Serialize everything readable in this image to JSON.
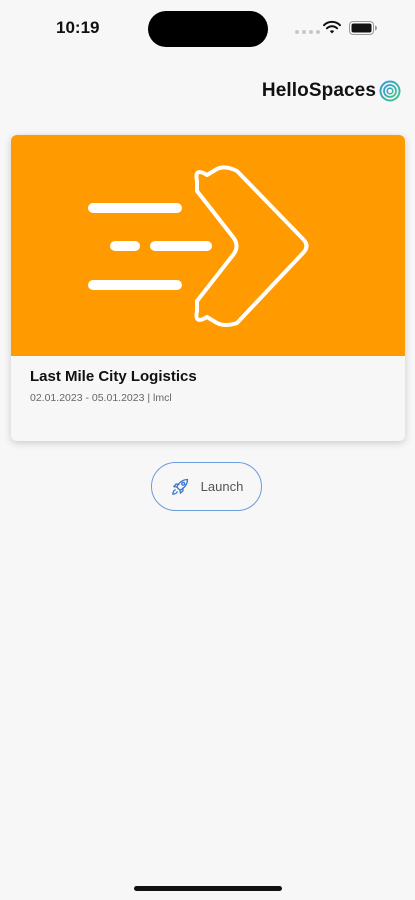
{
  "status_bar": {
    "time": "10:19"
  },
  "brand": {
    "name": "HelloSpaces",
    "logo_icon": "hellospaces-swirl-logo"
  },
  "card": {
    "title": "Last Mile City Logistics",
    "meta": "02.01.2023 - 05.01.2023 | lmcl",
    "image_icon": "fast-forward-arrow-icon",
    "image_color": "#ff9a00"
  },
  "launch": {
    "label": "Launch",
    "icon": "rocket-icon",
    "accent": "#6a9cde"
  },
  "colors": {
    "background": "#f7f7f8",
    "text": "#111111"
  }
}
